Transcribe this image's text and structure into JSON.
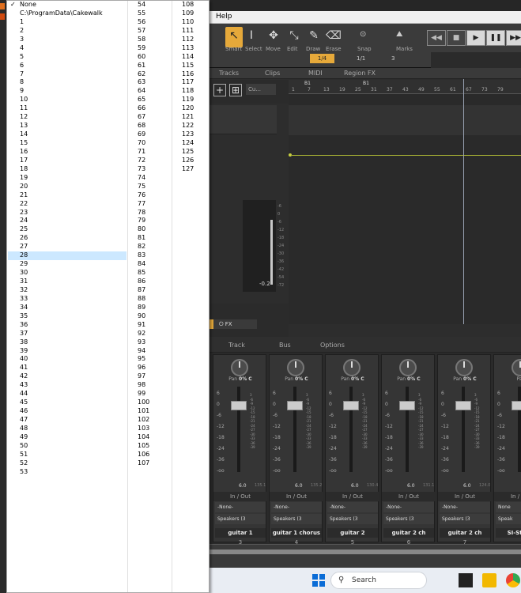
{
  "menu": {
    "col1": [
      "None",
      "C:\\ProgramData\\Cakewalk",
      "1",
      "2",
      "3",
      "4",
      "5",
      "6",
      "7",
      "8",
      "9",
      "10",
      "11",
      "12",
      "13",
      "14",
      "15",
      "16",
      "17",
      "18",
      "19",
      "20",
      "21",
      "22",
      "23",
      "24",
      "25",
      "26",
      "27",
      "28",
      "29",
      "30",
      "31",
      "32",
      "33",
      "34",
      "35",
      "36",
      "37",
      "38",
      "39",
      "40",
      "41",
      "42",
      "43",
      "44",
      "45",
      "46",
      "47",
      "48",
      "49",
      "50",
      "51",
      "52",
      "53"
    ],
    "col2": [
      "54",
      "55",
      "56",
      "57",
      "58",
      "59",
      "60",
      "61",
      "62",
      "63",
      "64",
      "65",
      "66",
      "67",
      "68",
      "69",
      "70",
      "71",
      "72",
      "73",
      "74",
      "75",
      "76",
      "77",
      "78",
      "79",
      "80",
      "81",
      "82",
      "83",
      "84",
      "85",
      "86",
      "87",
      "88",
      "89",
      "90",
      "91",
      "92",
      "93",
      "94",
      "95",
      "96",
      "97",
      "98",
      "99",
      "100",
      "101",
      "102",
      "103",
      "104",
      "105",
      "106",
      "107"
    ],
    "col3": [
      "108",
      "109",
      "110",
      "111",
      "112",
      "113",
      "114",
      "115",
      "116",
      "117",
      "118",
      "119",
      "120",
      "121",
      "122",
      "123",
      "124",
      "125",
      "126",
      "127"
    ],
    "checked": "None",
    "selected": "28",
    "selected_color": "#cce8ff"
  },
  "app": {
    "menubar": {
      "help": "Help"
    },
    "tools": [
      {
        "label": "Smart",
        "icon": "arrow-icon",
        "glyph": "↖"
      },
      {
        "label": "Select",
        "icon": "ibeam-icon",
        "glyph": "I"
      },
      {
        "label": "Move",
        "icon": "move-icon",
        "glyph": "✥"
      },
      {
        "label": "Edit",
        "icon": "edit-icon",
        "glyph": "⤡"
      },
      {
        "label": "Draw",
        "icon": "pencil-icon",
        "glyph": "✎"
      },
      {
        "label": "Erase",
        "icon": "eraser-icon",
        "glyph": "⌫"
      }
    ],
    "snap": {
      "label": "Snap",
      "value": "1/4",
      "grid": "1/1",
      "count": "3"
    },
    "marks": "Marks",
    "accent": "#e6a93a",
    "tabs": [
      "Tracks",
      "Clips",
      "MIDI",
      "Region FX"
    ],
    "cu_label": "Cu...",
    "ruler": {
      "flags": [
        "B1",
        "B1"
      ],
      "ticks": [
        "1",
        "7",
        "13",
        "19",
        "25",
        "31",
        "37",
        "43",
        "49",
        "55",
        "61",
        "67",
        "73",
        "79"
      ]
    },
    "meter": {
      "value": "-0.2",
      "scale": [
        "-6",
        "0",
        "-6",
        "-12",
        "-18",
        "-24",
        "-30",
        "-36",
        "-42",
        "-54",
        "-72"
      ]
    },
    "fx_label": "FX",
    "console_tabs": [
      "Track",
      "Bus",
      "Options"
    ],
    "strips": [
      {
        "pan": "0% C",
        "vol": "6.0",
        "peak": "135.1",
        "in": "-None-",
        "out": "Speakers (3",
        "name": "guitar 1",
        "num": "3"
      },
      {
        "pan": "0% C",
        "vol": "6.0",
        "peak": "135.2",
        "in": "-None-",
        "out": "Speakers (3",
        "name": "guitar 1 chorus",
        "num": "4"
      },
      {
        "pan": "0% C",
        "vol": "6.0",
        "peak": "130.4",
        "in": "-None-",
        "out": "Speakers (3",
        "name": "guitar 2",
        "num": "5"
      },
      {
        "pan": "0% C",
        "vol": "6.0",
        "peak": "131.1",
        "in": "-None-",
        "out": "Speakers (3",
        "name": "guitar 2 ch",
        "num": "6"
      },
      {
        "pan": "0% C",
        "vol": "6.0",
        "peak": "124.0",
        "in": "-None-",
        "out": "Speakers (3",
        "name": "guitar 2 ch",
        "num": "7"
      },
      {
        "pan": "",
        "vol": "",
        "peak": "",
        "in": "None",
        "out": "Speak",
        "name": "SI-String",
        "num": ""
      }
    ],
    "pan_label": "Pan",
    "inout_label": "In / Out",
    "fader_scale": [
      "6",
      "0",
      "-6",
      "-12",
      "-18",
      "-24",
      "-36",
      "-oo"
    ],
    "meter_scale": [
      "3",
      "-6",
      "-9",
      "-12",
      "-15",
      "-18",
      "-21",
      "-24",
      "-27",
      "-30",
      "-33",
      "-36",
      "-39"
    ]
  },
  "taskbar": {
    "search_placeholder": "Search"
  }
}
